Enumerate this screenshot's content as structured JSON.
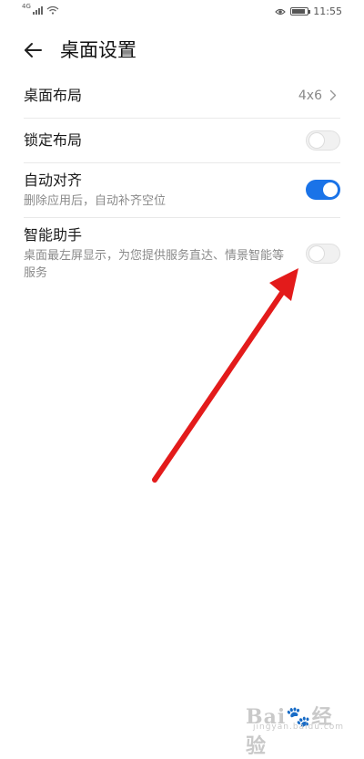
{
  "status_bar": {
    "network": "4G",
    "time": "11:55",
    "battery_level": 0.85
  },
  "header": {
    "title": "桌面设置",
    "back_icon": "arrow-left-icon"
  },
  "settings": [
    {
      "title": "桌面布局",
      "value": "4x6",
      "control": "chevron"
    },
    {
      "title": "锁定布局",
      "control": "toggle",
      "on": false
    },
    {
      "title": "自动对齐",
      "subtitle": "删除应用后，自动补齐空位",
      "control": "toggle",
      "on": true
    },
    {
      "title": "智能助手",
      "subtitle": "桌面最左屏显示，为您提供服务直达、情景智能等服务",
      "control": "toggle",
      "on": false
    }
  ],
  "annotation": {
    "color": "#e31b1b",
    "icon": "red-arrow-icon"
  },
  "watermark": {
    "brand": "Bai du 经验",
    "domain": "jingyan.baidu.com"
  },
  "colors": {
    "toggle_on": "#1a73e8",
    "toggle_off": "#f1f1f1"
  }
}
